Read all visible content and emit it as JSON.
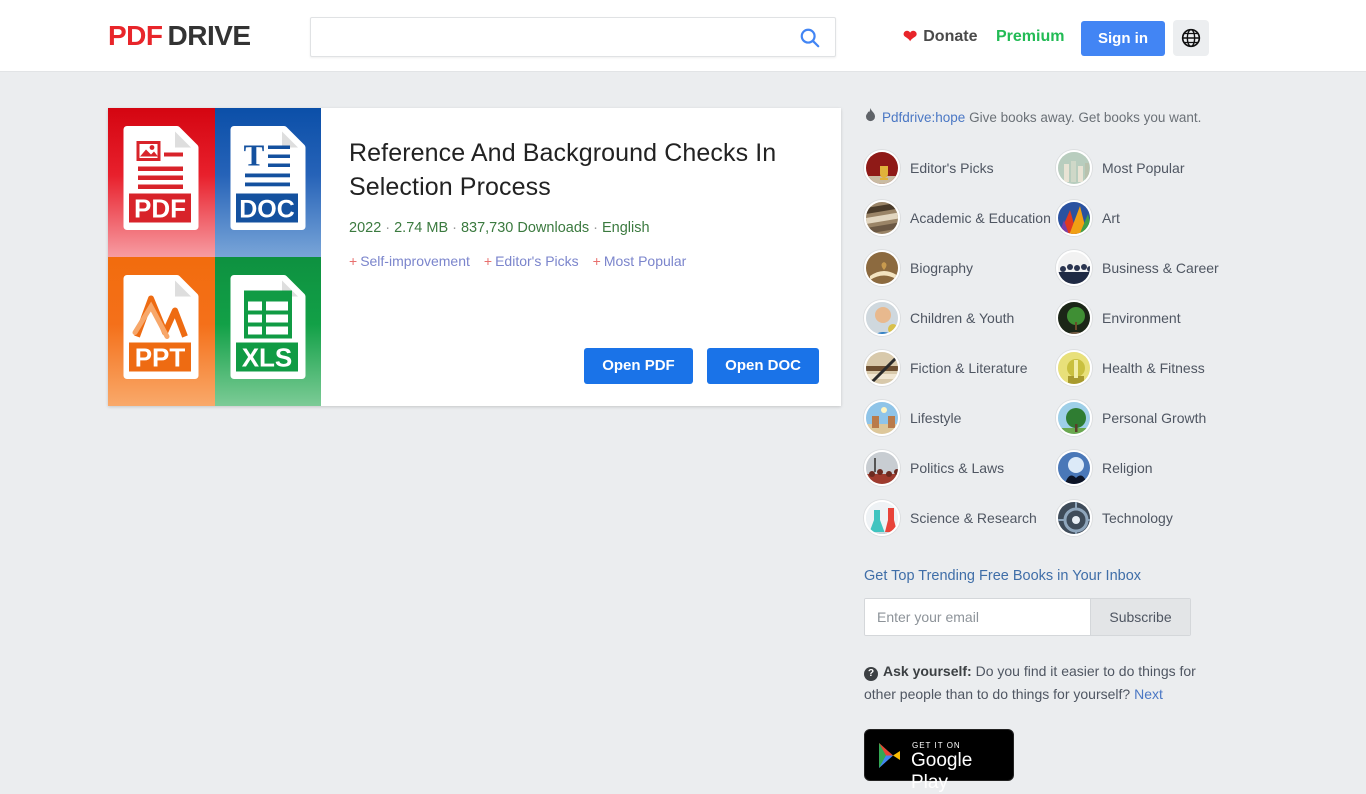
{
  "header": {
    "logo_pdf": "PDF",
    "logo_drive": "DRIVE",
    "search_value": "",
    "search_placeholder": "",
    "search_icon": "search-icon",
    "donate_label": "Donate",
    "donate_icon": "heart-icon",
    "premium_label": "Premium",
    "signin_label": "Sign in",
    "language_icon": "globe-icon",
    "accent_blue": "#4285f4",
    "logo_red": "#e8252a",
    "premium_green": "#22bb55"
  },
  "book": {
    "title": "Reference And Background Checks In Selection Process",
    "year": "2022",
    "size": "2.74 MB",
    "downloads": "837,730 Downloads",
    "language": "English",
    "separator": "·",
    "tags": [
      {
        "plus": "+",
        "label": "Self-improvement"
      },
      {
        "plus": "+",
        "label": "Editor's Picks"
      },
      {
        "plus": "+",
        "label": "Most Popular"
      }
    ],
    "open_pdf_label": "Open PDF",
    "open_doc_label": "Open DOC",
    "thumbnail_tiles": [
      {
        "type": "PDF",
        "color": "#e8202c"
      },
      {
        "type": "DOC",
        "color": "#2663b8"
      },
      {
        "type": "PPT",
        "color": "#f4701a"
      },
      {
        "type": "XLS",
        "color": "#12a047"
      }
    ]
  },
  "sidebar": {
    "hope_icon": "flame-icon",
    "hope_link": "Pdfdrive:hope",
    "hope_text": " Give books away. Get books you want.",
    "categories": [
      {
        "label": "Editor's Picks",
        "avatar": "trophy-photo"
      },
      {
        "label": "Most Popular",
        "avatar": "books-photo"
      },
      {
        "label": "Academic & Education",
        "avatar": "library-photo"
      },
      {
        "label": "Art",
        "avatar": "palette-photo"
      },
      {
        "label": "Biography",
        "avatar": "open-book-photo"
      },
      {
        "label": "Business & Career",
        "avatar": "crowd-photo"
      },
      {
        "label": "Children & Youth",
        "avatar": "child-photo"
      },
      {
        "label": "Environment",
        "avatar": "sapling-photo"
      },
      {
        "label": "Fiction & Literature",
        "avatar": "books-quill-photo"
      },
      {
        "label": "Health & Fitness",
        "avatar": "wellness-photo"
      },
      {
        "label": "Lifestyle",
        "avatar": "beach-photo"
      },
      {
        "label": "Personal Growth",
        "avatar": "tree-photo"
      },
      {
        "label": "Politics & Laws",
        "avatar": "protest-photo"
      },
      {
        "label": "Religion",
        "avatar": "hands-light-photo"
      },
      {
        "label": "Science & Research",
        "avatar": "lab-flasks-photo"
      },
      {
        "label": "Technology",
        "avatar": "circuit-photo"
      }
    ],
    "newsletter": {
      "title": "Get Top Trending Free Books in Your Inbox",
      "email_value": "",
      "email_placeholder": "Enter your email",
      "subscribe_label": "Subscribe"
    },
    "ask": {
      "icon": "question-mark-icon",
      "label": "Ask yourself:",
      "text": " Do you find it easier to do things for other people than to do things for yourself? ",
      "next_label": "Next"
    },
    "google_play": {
      "get_it_on": "GET IT ON",
      "store_name": "Google Play",
      "icon": "google-play-icon"
    }
  }
}
